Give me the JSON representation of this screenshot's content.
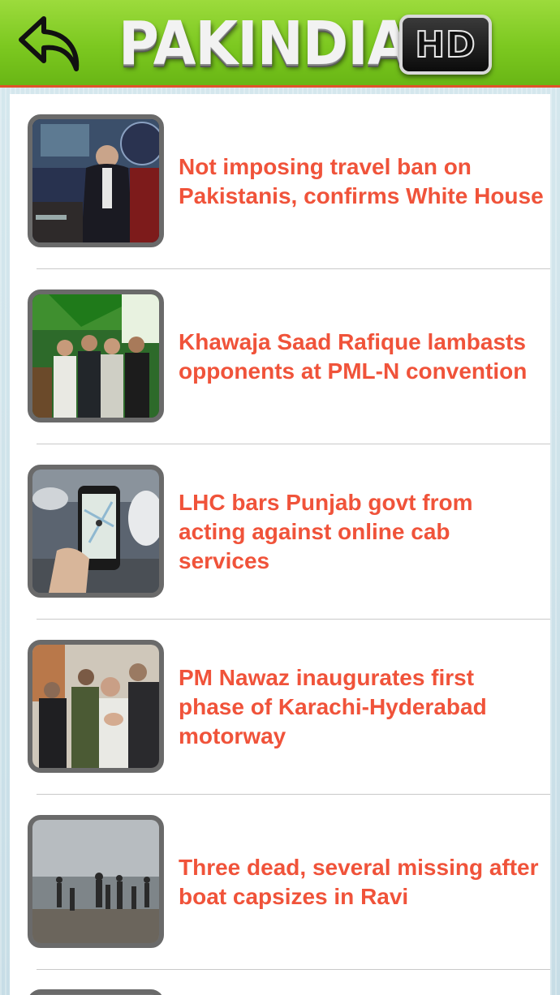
{
  "app": {
    "logo_text": "PAKINDIA",
    "logo_badge": "HD",
    "brand_colors": {
      "header_green": "#7cc820",
      "headline_red": "#f0533a",
      "header_border": "#e0532a"
    }
  },
  "header": {
    "back_icon": "back-arrow-icon"
  },
  "news": [
    {
      "title": "Not imposing travel ban on Pakistanis, confirms White House",
      "thumb": "press-briefing-image"
    },
    {
      "title": "Khawaja Saad Rafique lambasts opponents at PML-N convention",
      "thumb": "rally-image"
    },
    {
      "title": "LHC bars Punjab govt from acting against online cab services",
      "thumb": "phone-map-image"
    },
    {
      "title": "PM Nawaz inaugurates first phase of Karachi-Hyderabad motorway",
      "thumb": "prayer-ceremony-image"
    },
    {
      "title": "Three dead, several missing after boat capsizes in Ravi",
      "thumb": "riverbank-crowd-image"
    }
  ]
}
